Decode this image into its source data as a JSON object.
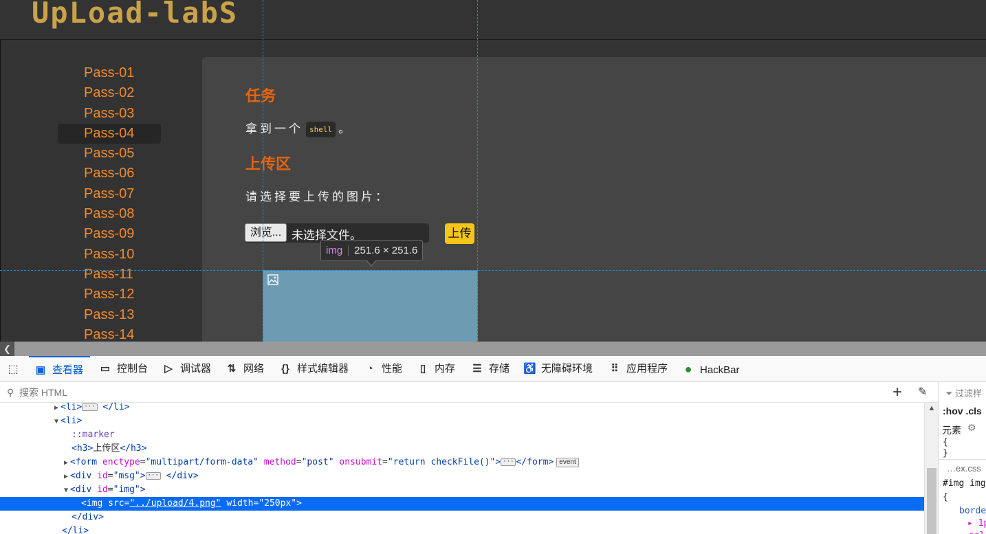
{
  "page": {
    "logo": "UpLoad-labS",
    "sidebar": {
      "items": [
        {
          "label": "Pass-01"
        },
        {
          "label": "Pass-02"
        },
        {
          "label": "Pass-03"
        },
        {
          "label": "Pass-04"
        },
        {
          "label": "Pass-05"
        },
        {
          "label": "Pass-06"
        },
        {
          "label": "Pass-07"
        },
        {
          "label": "Pass-08"
        },
        {
          "label": "Pass-09"
        },
        {
          "label": "Pass-10"
        },
        {
          "label": "Pass-11"
        },
        {
          "label": "Pass-12"
        },
        {
          "label": "Pass-13"
        },
        {
          "label": "Pass-14"
        }
      ],
      "active": "Pass-04"
    },
    "task_heading": "任务",
    "task_text_before": "拿到一个",
    "task_code": "shell",
    "task_text_after": "。",
    "upload_heading": "上传区",
    "upload_prompt": "请选择要上传的图片：",
    "browse_label": "浏览...",
    "no_file_text": "未选择文件。",
    "upload_button": "上传"
  },
  "inspector_tooltip": {
    "tag": "img",
    "dims": "251.6 × 251.6"
  },
  "devtools": {
    "tabs": [
      {
        "icon": "inspector-icon",
        "glyph": "▣",
        "label": "查看器",
        "active": true
      },
      {
        "icon": "console-icon",
        "glyph": "▭",
        "label": "控制台"
      },
      {
        "icon": "debugger-icon",
        "glyph": "▷",
        "label": "调试器"
      },
      {
        "icon": "network-icon",
        "glyph": "⇅",
        "label": "网络"
      },
      {
        "icon": "style-editor-icon",
        "glyph": "{}",
        "label": "样式编辑器"
      },
      {
        "icon": "performance-icon",
        "glyph": "◔",
        "label": "性能"
      },
      {
        "icon": "memory-icon",
        "glyph": "▯",
        "label": "内存"
      },
      {
        "icon": "storage-icon",
        "glyph": "☰",
        "label": "存储"
      },
      {
        "icon": "accessibility-icon",
        "glyph": "♿",
        "label": "无障碍环境"
      },
      {
        "icon": "application-icon",
        "glyph": "⠿",
        "label": "应用程序"
      },
      {
        "icon": "hackbar-icon",
        "glyph": "●",
        "label": "HackBar"
      }
    ],
    "search_placeholder": "搜索 HTML",
    "markup": {
      "line1_tag_open": "<li>",
      "line1_tag_close": "</li>",
      "line2": "<li>",
      "line3": "::marker",
      "line4_open": "<h3>",
      "line4_text": "上传区",
      "line4_close": "</h3>",
      "line5_tag": "<form",
      "line5_attr1": "enctype",
      "line5_val1": "\"multipart/form-data\"",
      "line5_attr2": "method",
      "line5_val2": "\"post\"",
      "line5_attr3": "onsubmit",
      "line5_val3": "\"return checkFile()\"",
      "line5_close": "</form>",
      "line5_badge": "event",
      "line6_tag": "<div",
      "line6_attr": "id",
      "line6_val": "\"msg\"",
      "line6_close": "</div>",
      "line7_tag": "<div",
      "line7_attr": "id",
      "line7_val": "\"img\"",
      "line8_tag": "<img",
      "line8_attr1": "src",
      "line8_val1": "\"../upload/4.png\"",
      "line8_attr2": "width",
      "line8_val2": "\"250px\"",
      "line9": "</div>",
      "line10": "</li>"
    },
    "rules": {
      "filter_placeholder": "过滤样",
      "hov_cls": ":hov .cls",
      "element_label": "元素",
      "brace_open": "{",
      "brace_close": "}",
      "source": "…ex.css",
      "selector": "#img img",
      "brace2": "{",
      "prop": "borde",
      "val": "▸ 1p",
      "val2": "sol"
    }
  }
}
